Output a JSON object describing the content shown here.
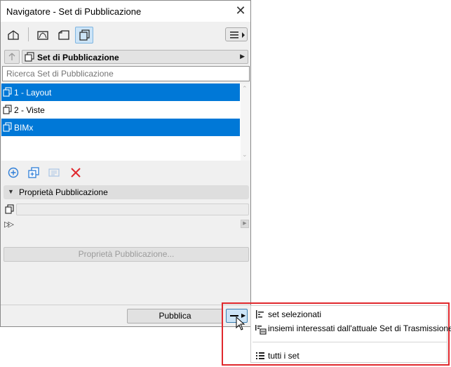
{
  "window": {
    "title": "Navigatore - Set di Pubblicazione",
    "close_glyph": "✕"
  },
  "toolbar": {
    "icons": [
      "project-map-icon",
      "view-map-icon",
      "layout-book-icon",
      "publisher-sets-icon"
    ],
    "selected": "publisher-sets-icon",
    "menu_icon": "hamburger-menu-icon"
  },
  "mode": {
    "label": "Set di Pubblicazione"
  },
  "search": {
    "placeholder": "Ricerca Set di Pubblicazione"
  },
  "sets": [
    {
      "label": "1 - Layout",
      "selected": true
    },
    {
      "label": "2 - Viste",
      "selected": false
    },
    {
      "label": "BIMx",
      "selected": true
    }
  ],
  "actions": [
    "add-icon",
    "duplicate-icon",
    "properties-icon",
    "delete-icon"
  ],
  "properties": {
    "title": "Proprietà Pubblicazione",
    "button_label": "Proprietà Pubblicazione..."
  },
  "footer": {
    "publish_label": "Pubblica"
  },
  "popup_menu": {
    "items": [
      {
        "label": "set selezionati",
        "icon": "selected-sets-icon"
      },
      {
        "label": "insiemi interessati dall'attuale Set di Trasmissione",
        "icon": "transmission-sets-icon"
      },
      {
        "label": "tutti i set",
        "icon": "all-sets-icon"
      }
    ]
  },
  "colors": {
    "selection": "#0078d7",
    "highlight_frame": "#e0282d",
    "delete": "#e0282d",
    "accent_blue": "#2e7ed8"
  }
}
